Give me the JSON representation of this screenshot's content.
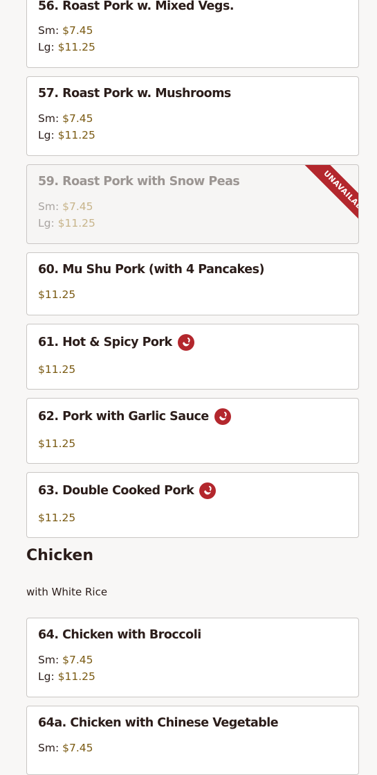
{
  "colors": {
    "accent_red": "#b3272d",
    "price": "#7a5a12",
    "text": "#2b1d1a",
    "card_border": "#c9c6c4"
  },
  "items": [
    {
      "name": "56. Roast Pork w. Mixed Vegs.",
      "sm_label": "Sm:",
      "sm_price": "$7.45",
      "lg_label": "Lg:",
      "lg_price": "$11.25"
    },
    {
      "name": "57. Roast Pork w. Mushrooms",
      "sm_label": "Sm:",
      "sm_price": "$7.45",
      "lg_label": "Lg:",
      "lg_price": "$11.25"
    },
    {
      "name": "59. Roast Pork with Snow Peas",
      "sm_label": "Sm:",
      "sm_price": "$7.45",
      "lg_label": "Lg:",
      "lg_price": "$11.25",
      "badge": "UNAVAILABLE"
    },
    {
      "name": "60. Mu Shu Pork (with 4 Pancakes)",
      "price": "$11.25"
    },
    {
      "name": "61. Hot & Spicy Pork",
      "price": "$11.25",
      "icon": "spicy-pepper-icon"
    },
    {
      "name": "62. Pork with Garlic Sauce",
      "price": "$11.25",
      "icon": "spicy-pepper-icon"
    },
    {
      "name": "63. Double Cooked Pork",
      "price": "$11.25",
      "icon": "spicy-pepper-icon"
    },
    {
      "name": "64. Chicken with Broccoli",
      "sm_label": "Sm:",
      "sm_price": "$7.45",
      "lg_label": "Lg:",
      "lg_price": "$11.25"
    },
    {
      "name": "64a. Chicken with Chinese Vegetable",
      "sm_label": "Sm:",
      "sm_price": "$7.45"
    }
  ],
  "section": {
    "title": "Chicken",
    "subtitle": "with White Rice"
  }
}
